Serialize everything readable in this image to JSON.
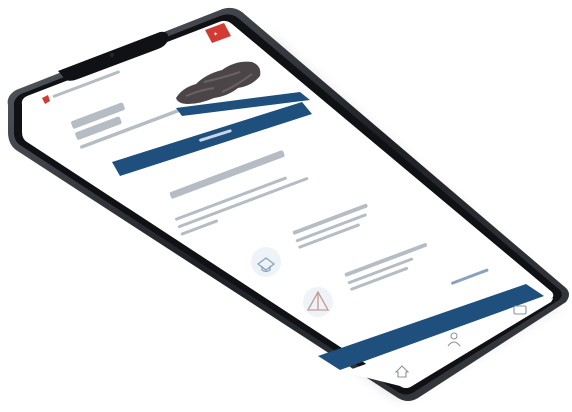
{
  "colors": {
    "brand_blue": "#1e4f7d",
    "brand_red": "#d13b34",
    "heading_blue": "#1f5a8c",
    "icon_circle": "#eef3f8",
    "text_line": "#b6bcc4"
  },
  "header": {
    "logo_icon": "austria-flag-icon",
    "site_name": "",
    "map_image": "austria-map"
  },
  "hero": {
    "title": "",
    "subtitle": "",
    "button_label": ""
  },
  "section": {
    "heading": "",
    "intro": ""
  },
  "services": [
    {
      "icon": "cap-icon",
      "title": "",
      "description": ""
    },
    {
      "icon": "tent-icon",
      "title": "",
      "description": ""
    }
  ],
  "more_link": "",
  "bottom_nav": [
    {
      "name": "home",
      "icon": "home-icon"
    },
    {
      "name": "person",
      "icon": "person-icon"
    },
    {
      "name": "wallet",
      "icon": "wallet-icon"
    }
  ]
}
